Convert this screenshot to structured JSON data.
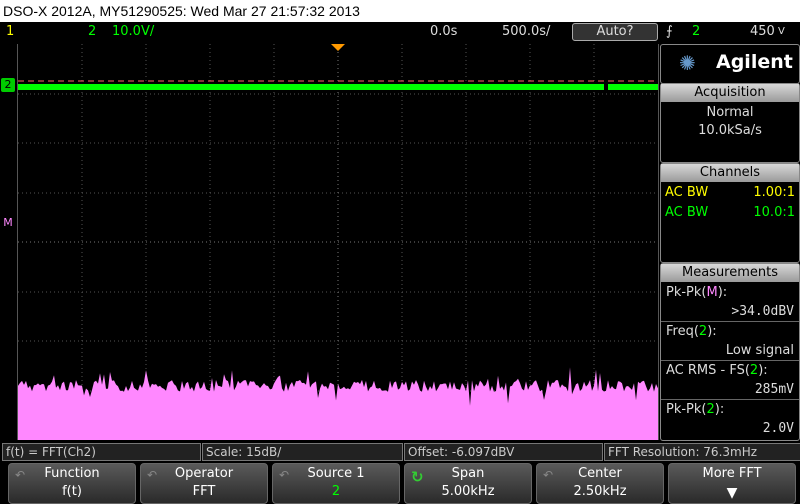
{
  "titlebar": {
    "text": "DSO-X 2012A, MY51290525: Wed Mar 27 21:57:32 2013"
  },
  "status": {
    "ch1_number": "1",
    "ch2_number": "2",
    "ch2_scale": "10.0V/",
    "delay": "0.0s",
    "timebase": "500.0s/",
    "trigger_mode": "Auto?",
    "trigger_edge_icon": "rising-edge-icon",
    "trigger_source": "2",
    "trigger_level": "450",
    "trigger_level_unit": "V"
  },
  "screen": {
    "markers": {
      "ch2_marker": "2",
      "math_marker": "M"
    },
    "colors": {
      "ch1": "#ffff00",
      "ch2": "#00ff00",
      "math": "#ff88ff",
      "grid": "#555555",
      "trigger": "#ff8800"
    }
  },
  "side": {
    "brand": "Agilent",
    "acquisition": {
      "title": "Acquisition",
      "mode": "Normal",
      "rate": "10.0kSa/s"
    },
    "channels": {
      "title": "Channels",
      "rows": [
        {
          "label": "AC BW",
          "value": "1.00:1",
          "color": "#ffff00"
        },
        {
          "label": "AC BW",
          "value": "10.0:1",
          "color": "#00ff00"
        }
      ]
    },
    "measurements": {
      "title": "Measurements",
      "items": [
        {
          "name": "Pk-Pk(",
          "src": "M",
          "close": "):",
          "value": ">34.0dBV",
          "src_color": "#ff88ff"
        },
        {
          "name": "Freq(",
          "src": "2",
          "close": "):",
          "value": "Low signal",
          "src_color": "#00ff00"
        },
        {
          "name": "AC RMS - FS(",
          "src": "2",
          "close": "):",
          "value": "285mV",
          "src_color": "#00ff00"
        },
        {
          "name": "Pk-Pk(",
          "src": "2",
          "close": "):",
          "value": "2.0V",
          "src_color": "#00ff00"
        }
      ]
    }
  },
  "infobar": {
    "func": "f(t) = FFT(Ch2)",
    "scale": "Scale: 15dB/",
    "offset": "Offset: -6.097dBV",
    "resolution": "FFT Resolution: 76.3mHz"
  },
  "softkeys": [
    {
      "title": "Function",
      "value": "f(t)"
    },
    {
      "title": "Operator",
      "value": "FFT"
    },
    {
      "title": "Source 1",
      "value": "2"
    },
    {
      "title": "Span",
      "value": "5.00kHz"
    },
    {
      "title": "Center",
      "value": "2.50kHz"
    },
    {
      "title": "More FFT",
      "value": ""
    }
  ]
}
